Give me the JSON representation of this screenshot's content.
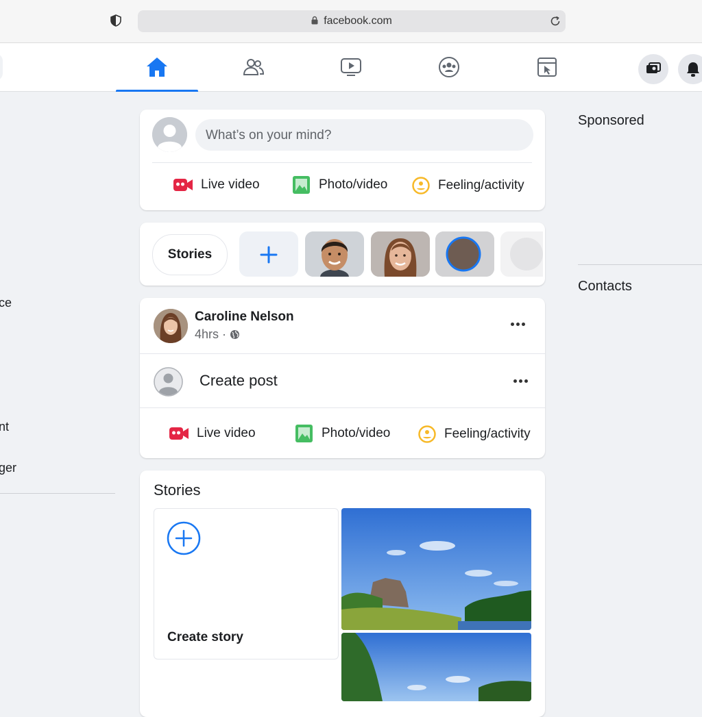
{
  "browser": {
    "url": "facebook.com"
  },
  "nav": {
    "tabs": [
      {
        "name": "home",
        "icon": "home-icon",
        "active": true
      },
      {
        "name": "friends",
        "icon": "friends-icon",
        "active": false
      },
      {
        "name": "watch",
        "icon": "video-icon",
        "active": false
      },
      {
        "name": "groups",
        "icon": "groups-icon",
        "active": false
      },
      {
        "name": "gaming",
        "icon": "gaming-icon",
        "active": false
      }
    ],
    "right_buttons": [
      "messenger-icon",
      "notifications-icon"
    ],
    "accent": "#1877f2"
  },
  "left_sidebar": {
    "partial_items": [
      "ce",
      "nt",
      "ger"
    ]
  },
  "composer": {
    "placeholder": "What’s on your mind?",
    "actions": [
      {
        "label": "Live video",
        "icon": "live-video-icon",
        "color": "#e42645"
      },
      {
        "label": "Photo/video",
        "icon": "photo-icon",
        "color": "#45bd62"
      },
      {
        "label": "Feeling/activity",
        "icon": "feeling-icon",
        "color": "#f7b928"
      }
    ]
  },
  "stories_bar": {
    "label": "Stories"
  },
  "post": {
    "author": "Caroline Nelson",
    "time": "4hrs ·",
    "create_label": "Create post",
    "actions": [
      {
        "label": "Live video"
      },
      {
        "label": "Photo/video"
      },
      {
        "label": "Feeling/activity"
      }
    ]
  },
  "stories_section": {
    "title": "Stories",
    "create_label": "Create story"
  },
  "right_column": {
    "sponsored": "Sponsored",
    "contacts": "Contacts"
  }
}
